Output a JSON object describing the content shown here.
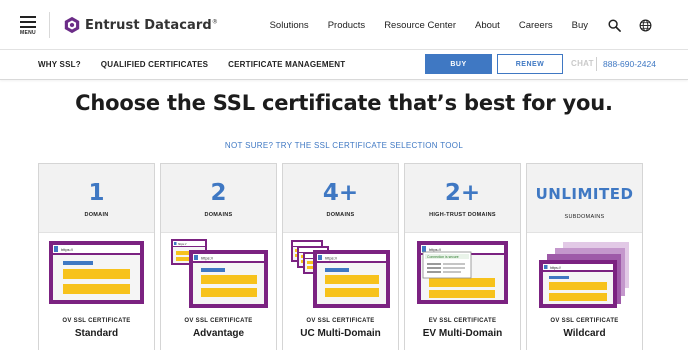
{
  "header": {
    "menu_label": "MENU",
    "brand_name": "Entrust Datacard",
    "brand_mark": "®",
    "nav": [
      {
        "label": "Solutions"
      },
      {
        "label": "Products"
      },
      {
        "label": "Resource Center"
      },
      {
        "label": "About"
      },
      {
        "label": "Careers"
      },
      {
        "label": "Buy"
      }
    ],
    "icons": [
      "search-icon",
      "globe-icon"
    ]
  },
  "subnav": {
    "links": [
      {
        "label": "WHY SSL?"
      },
      {
        "label": "QUALIFIED CERTIFICATES"
      },
      {
        "label": "CERTIFICATE MANAGEMENT"
      }
    ],
    "buy_label": "BUY",
    "renew_label": "RENEW",
    "chat_label": "CHAT",
    "phone": "888-690-2424"
  },
  "main": {
    "headline": "Choose the SSL certificate that’s best for you.",
    "tool_link": "NOT SURE? TRY THE SSL CERTIFICATE SELECTION TOOL"
  },
  "cards": [
    {
      "count": "1",
      "unit": "DOMAIN",
      "type": "OV SSL CERTIFICATE",
      "name": "Standard"
    },
    {
      "count": "2",
      "unit": "DOMAINS",
      "type": "OV SSL CERTIFICATE",
      "name": "Advantage"
    },
    {
      "count": "4+",
      "unit": "DOMAINS",
      "type": "OV SSL CERTIFICATE",
      "name": "UC Multi-Domain"
    },
    {
      "count": "2+",
      "unit": "HIGH-TRUST DOMAINS",
      "type": "EV SSL CERTIFICATE",
      "name": "EV Multi-Domain"
    },
    {
      "count": "UNLIMITED",
      "unit": "SUBDOMAINS",
      "type": "OV SSL CERTIFICATE",
      "name": "Wildcard"
    }
  ],
  "illustration_text": {
    "url": "https://",
    "secure_note": "Connection is secure"
  },
  "colors": {
    "accent_blue": "#3f78c3",
    "frame_purple": "#7b2281",
    "content_yellow": "#f7c21c",
    "logo_purple": "#6b2c87"
  }
}
